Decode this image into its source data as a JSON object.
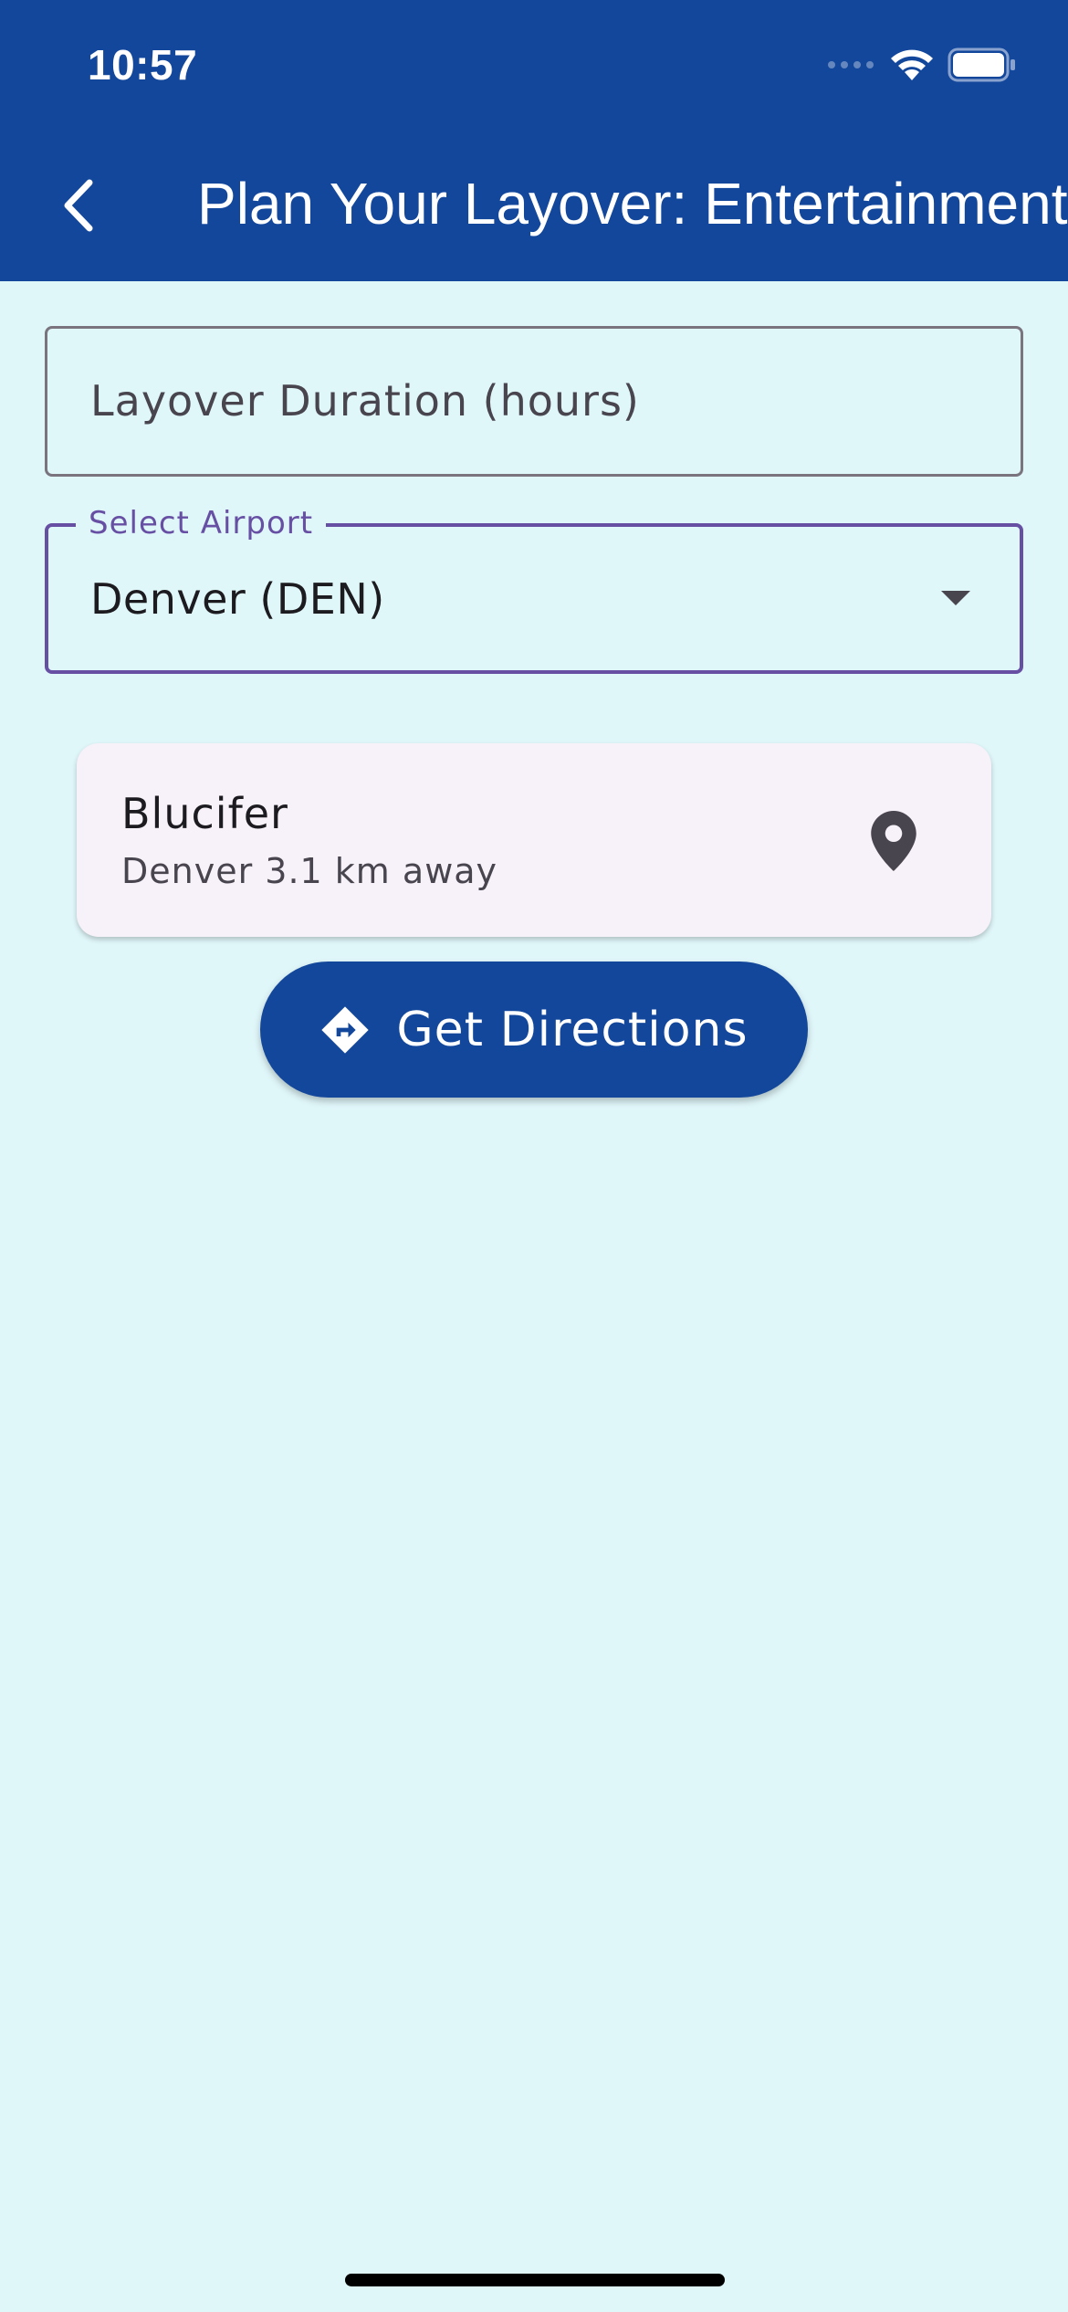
{
  "status_bar": {
    "time": "10:57",
    "icons": [
      "cellular-signal-icon",
      "wifi-icon",
      "battery-icon"
    ]
  },
  "app_bar": {
    "title": "Plan Your Layover: Entertainment",
    "back_icon": "chevron-left-icon",
    "background_color": "#13479c"
  },
  "form": {
    "duration_field": {
      "placeholder": "Layover Duration (hours)",
      "value": ""
    },
    "airport_select": {
      "label": "Select Airport",
      "selected": "Denver (DEN)",
      "icon": "dropdown-arrow-icon",
      "accent_color": "#6750a4"
    }
  },
  "results": [
    {
      "title": "Blucifer",
      "subtitle": "Denver 3.1 km away",
      "icon": "location-pin-icon"
    }
  ],
  "directions_button": {
    "label": "Get Directions",
    "icon": "directions-icon"
  },
  "colors": {
    "background": "#e0f7fa",
    "card": "#f7f1f9",
    "primary": "#13479c"
  }
}
